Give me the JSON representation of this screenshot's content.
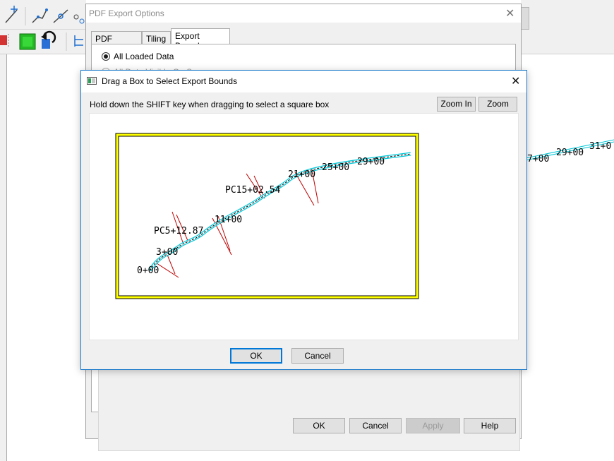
{
  "background": {
    "station_labels": [
      "7+00",
      "29+00",
      "31+0"
    ]
  },
  "pdf_dialog": {
    "title": "PDF Export Options",
    "tabs": [
      {
        "label": "PDF Options"
      },
      {
        "label": "Tiling"
      },
      {
        "label": "Export Bounds"
      }
    ],
    "active_tab": "Export Bounds",
    "options": [
      {
        "label": "All Loaded Data",
        "selected": true
      },
      {
        "label": "All Data Visible On Screen",
        "selected": false
      }
    ],
    "buttons": {
      "ok": "OK",
      "cancel": "Cancel",
      "apply": "Apply",
      "help": "Help"
    }
  },
  "drag_dialog": {
    "title": "Drag a Box to Select Export Bounds",
    "instruction": "Hold down the SHIFT key when dragging to select a square box",
    "zoom_in": "Zoom In",
    "zoom_out": "Zoom Out",
    "ok": "OK",
    "cancel": "Cancel",
    "selection_color": "#ffff00",
    "alignment_color": "#00c8d8",
    "crossline_color": "#c00000",
    "station_labels": [
      "0+00",
      "3+00",
      "PC5+12.87",
      "11+00",
      "PC15+02.54",
      "21+00",
      "25+00",
      "29+00"
    ]
  }
}
